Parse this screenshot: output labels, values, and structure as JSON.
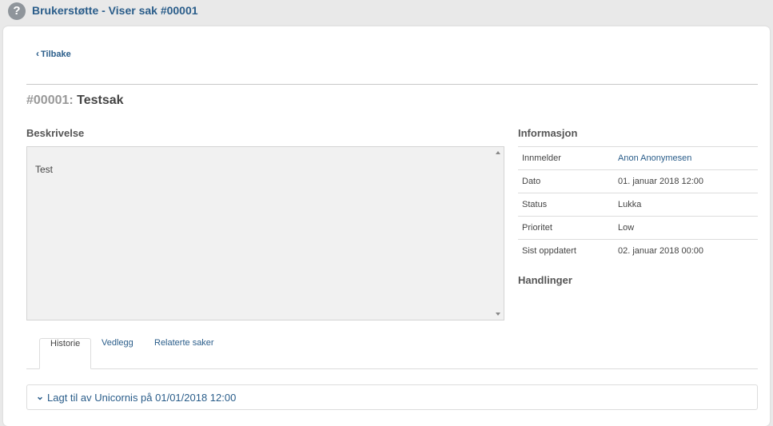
{
  "header": {
    "help_icon_glyph": "?",
    "title": "Brukerstøtte - Viser sak #00001"
  },
  "nav": {
    "back_label": "Tilbake"
  },
  "case": {
    "number": "#00001:",
    "title": "Testsak"
  },
  "description": {
    "heading": "Beskrivelse",
    "text": "Test"
  },
  "information": {
    "heading": "Informasjon",
    "rows": [
      {
        "label": "Innmelder",
        "value": "Anon Anonymesen"
      },
      {
        "label": "Dato",
        "value": "01. januar 2018 12:00"
      },
      {
        "label": "Status",
        "value": "Lukka"
      },
      {
        "label": "Prioritet",
        "value": "Low"
      },
      {
        "label": "Sist oppdatert",
        "value": "02. januar 2018 00:00"
      }
    ]
  },
  "actions": {
    "heading": "Handlinger"
  },
  "tabs": [
    {
      "label": "Historie",
      "active": true
    },
    {
      "label": "Vedlegg",
      "active": false
    },
    {
      "label": "Relaterte saker",
      "active": false
    }
  ],
  "history": {
    "entry": "Lagt til av Unicornis på 01/01/2018 12:00"
  },
  "colors": {
    "link": "#2a5d8a",
    "background": "#e9e9e9",
    "panel": "#ffffff"
  }
}
